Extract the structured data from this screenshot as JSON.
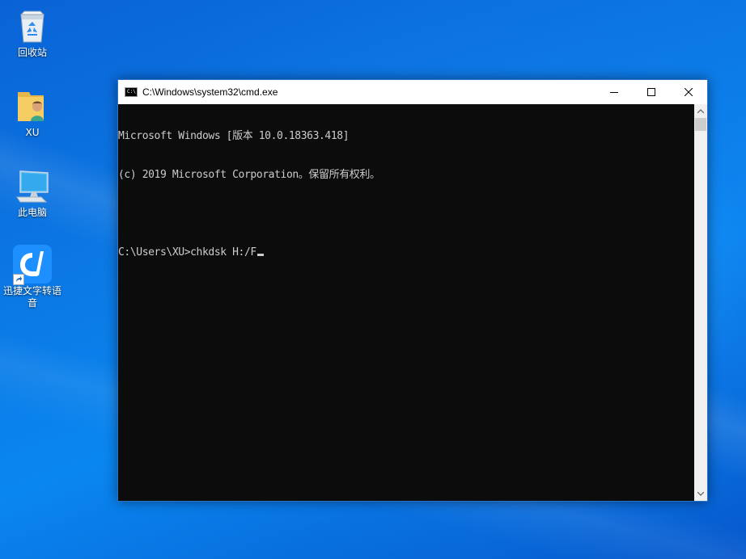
{
  "desktop": {
    "icons": [
      {
        "label": "回收站",
        "icon": "recycle-bin-icon"
      },
      {
        "label": "XU",
        "icon": "user-folder-icon"
      },
      {
        "label": "此电脑",
        "icon": "computer-icon"
      },
      {
        "label": "迅捷文字转语音",
        "icon": "app-logo-icon"
      }
    ]
  },
  "window": {
    "title": "C:\\Windows\\system32\\cmd.exe",
    "icon_text": "C:\\",
    "buttons": {
      "minimize": "minimize-icon",
      "maximize": "maximize-icon",
      "close": "close-icon"
    }
  },
  "console": {
    "lines": [
      "Microsoft Windows [版本 10.0.18363.418]",
      "(c) 2019 Microsoft Corporation。保留所有权利。",
      "",
      "C:\\Users\\XU>chkdsk H:/F"
    ]
  },
  "colors": {
    "console_bg": "#0c0c0c",
    "console_text": "#cccccc",
    "titlebar_bg": "#ffffff",
    "window_border": "#2b73c9"
  }
}
